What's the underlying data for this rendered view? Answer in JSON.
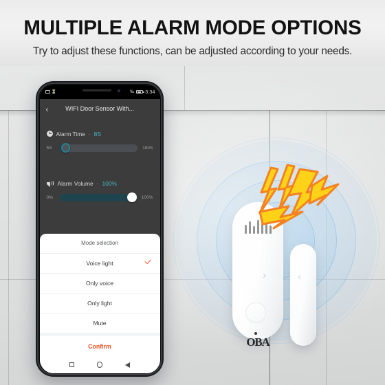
{
  "header": {
    "title": "MULTIPLE ALARM MODE OPTIONS",
    "subtitle": "Try to adjust these functions, can be adjusted according to your needs."
  },
  "phone": {
    "statusbar": {
      "time": "3:34",
      "left_icons": [
        "sim-icon",
        "signal-icon"
      ],
      "right_icons": [
        "percent-icon",
        "battery-icon"
      ]
    },
    "navbar": {
      "back_icon": "chevron-left-icon",
      "title": "WIFI Door Sensor With..."
    },
    "alarm_time": {
      "icon": "clock-icon",
      "label": "Alarm Time",
      "separator": "·",
      "value": "8S",
      "min_label": "5S",
      "max_label": "180S",
      "fill_percent": 2,
      "accent": "#49b6c4"
    },
    "alarm_volume": {
      "icon": "volume-icon",
      "label": "Alarm Volume",
      "separator": "·",
      "value": "100%",
      "min_label": "0%",
      "max_label": "100%",
      "fill_percent": 100,
      "accent": "#49b6c4"
    },
    "sheet": {
      "header": "Mode selection",
      "options": [
        {
          "label": "Voice light",
          "selected": true
        },
        {
          "label": "Only voice",
          "selected": false
        },
        {
          "label": "Only light",
          "selected": false
        },
        {
          "label": "Mute",
          "selected": false
        }
      ],
      "confirm_label": "Confirm",
      "confirm_color": "#f4511e",
      "check_icon": "check-icon"
    },
    "android_nav": {
      "recent_icon": "square-icon",
      "home_icon": "circle-icon",
      "back_icon": "triangle-back-icon"
    }
  },
  "scene": {
    "device_brand": "OBA",
    "device_icons": {
      "grille": "speaker-grille-icon",
      "arrow_right": "›",
      "arrow_left": "‹",
      "button": "round-button-icon",
      "led": "led-indicator-icon"
    },
    "alert_icon": "lightning-bolts-icon",
    "ring_icon": "sonar-rings-icon",
    "colors": {
      "bolt_fill": "#ffd21a",
      "bolt_stroke": "#f5821f",
      "ring_blue": "#5ba3db",
      "wall": "#e3e4e4"
    }
  }
}
